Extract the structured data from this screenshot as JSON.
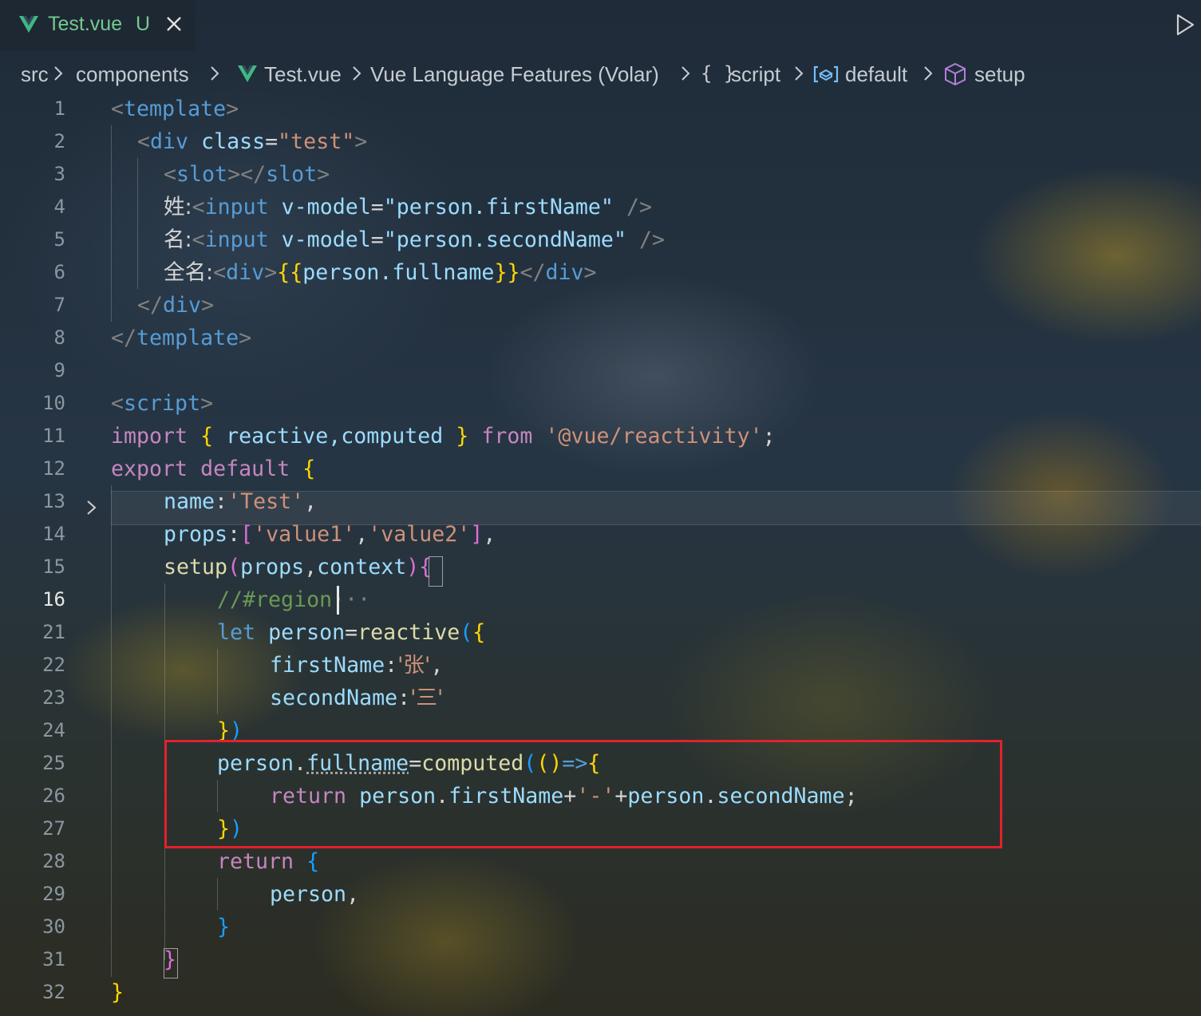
{
  "tab": {
    "name": "Test.vue",
    "badge": "U"
  },
  "breadcrumb": [
    {
      "label": "src"
    },
    {
      "label": "components"
    },
    {
      "label": "Test.vue",
      "icon": "vue-icon"
    },
    {
      "label": "Vue Language Features (Volar)"
    },
    {
      "label": "script",
      "icon": "braces-icon"
    },
    {
      "label": "default",
      "icon": "symbol-variable-icon"
    },
    {
      "label": "setup",
      "icon": "cube-method-icon"
    }
  ],
  "breadcrumb_icons": {
    "script": "{ }"
  },
  "line_numbers": [
    "1",
    "2",
    "3",
    "4",
    "5",
    "6",
    "7",
    "8",
    "9",
    "10",
    "11",
    "12",
    "13",
    "14",
    "15",
    "16",
    "21",
    "22",
    "23",
    "24",
    "25",
    "26",
    "27",
    "28",
    "29",
    "30",
    "31",
    "32"
  ],
  "active_line": "16",
  "code": {
    "l1": [
      "<",
      "template",
      ">"
    ],
    "l2": [
      "<",
      "div",
      " ",
      "class",
      "=",
      "\"test\"",
      ">"
    ],
    "l3": [
      "<",
      "slot",
      "></",
      "slot",
      ">"
    ],
    "l4": [
      "姓:",
      "<",
      "input",
      " ",
      "v-model",
      "=",
      "\"person.firstName\"",
      " />"
    ],
    "l5": [
      "名:",
      "<",
      "input",
      " ",
      "v-model",
      "=",
      "\"person.secondName\"",
      " />"
    ],
    "l6": [
      "全名:",
      "<",
      "div",
      ">",
      "{{",
      "person.fullname",
      "}}",
      "</",
      "div",
      ">"
    ],
    "l7": [
      "</",
      "div",
      ">"
    ],
    "l8": [
      "</",
      "template",
      ">"
    ],
    "l10": [
      "<",
      "script",
      ">"
    ],
    "l11": [
      "import",
      " ",
      "{",
      " reactive,computed ",
      "}",
      " ",
      "from",
      " ",
      "'@vue/reactivity'",
      ";"
    ],
    "l12": [
      "export",
      " ",
      "default",
      " ",
      "{"
    ],
    "l13": [
      "name",
      ":",
      "'Test'",
      ","
    ],
    "l14": [
      "props",
      ":",
      "[",
      "'value1'",
      ",",
      "'value2'",
      "]",
      ","
    ],
    "l15": [
      "setup",
      "(",
      "props",
      ",",
      "context",
      ")",
      "{"
    ],
    "l16": [
      "//#region",
      "···"
    ],
    "l21": [
      "let",
      " ",
      "person",
      "=",
      "reactive",
      "(",
      "{"
    ],
    "l22": [
      "firstName",
      ":",
      "'张'",
      ","
    ],
    "l23": [
      "secondName",
      ":",
      "'三'"
    ],
    "l24": [
      "}",
      ")"
    ],
    "l25": [
      "person",
      ".",
      "fullname",
      "=",
      "computed",
      "(",
      "()",
      "=>",
      "{"
    ],
    "l26": [
      "return",
      " ",
      "person",
      ".",
      "firstName",
      "+",
      "'-'",
      "+",
      "person",
      ".",
      "secondName",
      ";"
    ],
    "l27": [
      "}",
      ")"
    ],
    "l28": [
      "return",
      " ",
      "{"
    ],
    "l29": [
      "person",
      ","
    ],
    "l30": [
      "}"
    ],
    "l31": [
      "}"
    ],
    "l32": [
      "}"
    ]
  },
  "colors": {
    "highlight_box": "#e3212b",
    "tab_modified": "#73c991",
    "vue_green": "#41b883"
  }
}
